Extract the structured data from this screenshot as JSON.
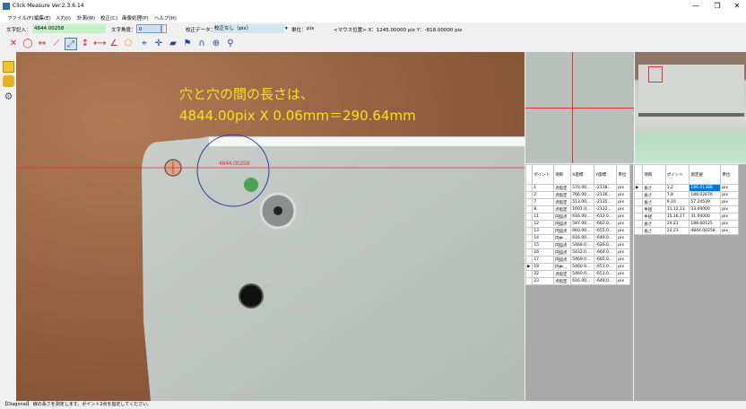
{
  "window": {
    "title": "Click Measure Ver.2.3.6.14",
    "minimize": "—",
    "maximize": "❐",
    "close": "✕"
  },
  "menu": [
    "ファイル(F)",
    "編集(E)",
    "入力(I)",
    "計測(M)",
    "校正(C)",
    "画像処理(P)",
    "ヘルプ(H)"
  ],
  "fields": {
    "text_input_label": "文字記入：",
    "text_input_value": "4844.00258",
    "text_angle_label": "文字角度：",
    "text_angle_value": "0",
    "calib_label": "校正データ：",
    "calib_value": "校正なし（pix）",
    "unit_label": "単位：",
    "unit_value": "pix",
    "mouse_position": "<マウス位置> X：1245.00000 pix  Y：-818.00000 pix"
  },
  "overlay": {
    "caption_line1": "穴と穴の間の長さは、",
    "caption_line2": "4844.00pix X 0.06mm＝290.64mm",
    "measure_label": "4844.00258"
  },
  "table1": {
    "headers": [
      "ポイント",
      "項目",
      "X座標",
      "Y座標",
      "単位"
    ],
    "rows": [
      [
        "1",
        "点指定",
        "570.00...",
        "-2138...",
        "pix"
      ],
      [
        "2",
        "点指定",
        "766.00...",
        "-2136...",
        "pix"
      ],
      [
        "7",
        "点指定",
        "513.00...",
        "-2135...",
        "pix"
      ],
      [
        "8",
        "点指定",
        "1001.0...",
        "-2132...",
        "pix"
      ],
      [
        "11",
        "円弧点",
        "616.00...",
        "-613.0...",
        "pix"
      ],
      [
        "12",
        "円弧点",
        "587.00...",
        "-662.0...",
        "pix"
      ],
      [
        "13",
        "円弧点",
        "660.00...",
        "-655.0...",
        "pix"
      ],
      [
        "14",
        "円中...",
        "616.00...",
        "-649.0...",
        "pix"
      ],
      [
        "15",
        "円弧点",
        "5468.0...",
        "-626.0...",
        "pix"
      ],
      [
        "16",
        "円弧点",
        "5432.0...",
        "-664.0...",
        "pix"
      ],
      [
        "17",
        "円弧点",
        "5469.0...",
        "-665.0...",
        "pix"
      ],
      [
        "19",
        "円中...",
        "5460.0...",
        "-651.0...",
        "pix"
      ],
      [
        "22",
        "点指定",
        "5460.0...",
        "-651.0...",
        "pix"
      ],
      [
        "23",
        "点指定",
        "616.00...",
        "-649.0...",
        "pix"
      ]
    ],
    "current_row_marker": "▶"
  },
  "table2": {
    "headers": [
      "項目",
      "ポイント",
      "測定値",
      "単位"
    ],
    "rows": [
      [
        "長さ",
        "1,2",
        "196.01388",
        "pix"
      ],
      [
        "長さ",
        "7,8",
        "188.02676",
        "pix"
      ],
      [
        "長さ",
        "9,10",
        "57.24539",
        "pix"
      ],
      [
        "半径",
        "11,12,13",
        "33.00000",
        "pix"
      ],
      [
        "半径",
        "15,16,17",
        "31.00000",
        "pix"
      ],
      [
        "長さ",
        "20,21",
        "188.00125",
        "pix"
      ],
      [
        "長さ",
        "22,23",
        "4844.00258",
        "pix"
      ]
    ],
    "current_row_marker": "▶"
  },
  "status": {
    "text": "【Diagonal】 線の長さを測定します。ポイント2点を指定してください。"
  },
  "colors": {
    "caption": "#f5e31a",
    "measure_line": "#e03030",
    "selection": "#0078d7"
  }
}
